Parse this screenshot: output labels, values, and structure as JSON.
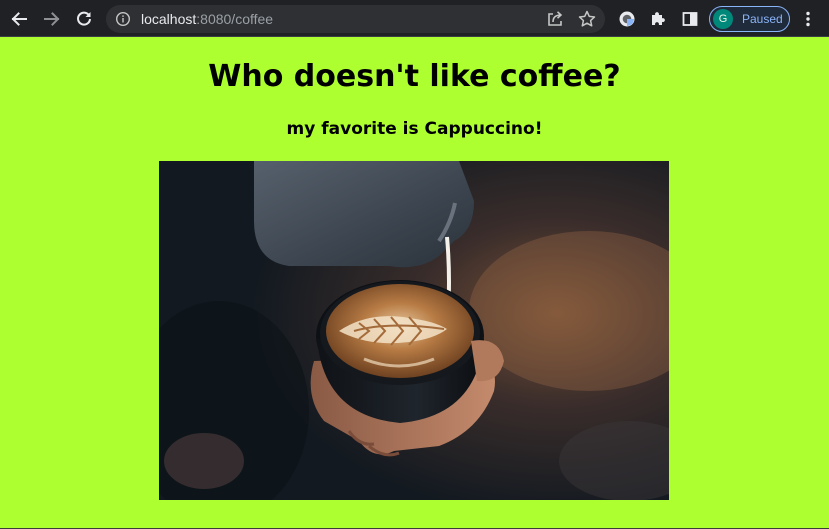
{
  "browser": {
    "url_host": "localhost",
    "url_rest": ":8080/coffee",
    "profile_initial": "G",
    "profile_status": "Paused",
    "icons": [
      "back-arrow-icon",
      "forward-arrow-icon",
      "reload-icon",
      "info-icon",
      "share-icon",
      "star-icon",
      "extension-icon",
      "puzzle-icon",
      "side-panel-icon",
      "kebab-menu-icon"
    ]
  },
  "page": {
    "heading": "Who doesn't like coffee?",
    "subheading": "my favorite is Cappuccino!",
    "background_color": "#adff2f",
    "image": "latte-art-pour-photo"
  }
}
